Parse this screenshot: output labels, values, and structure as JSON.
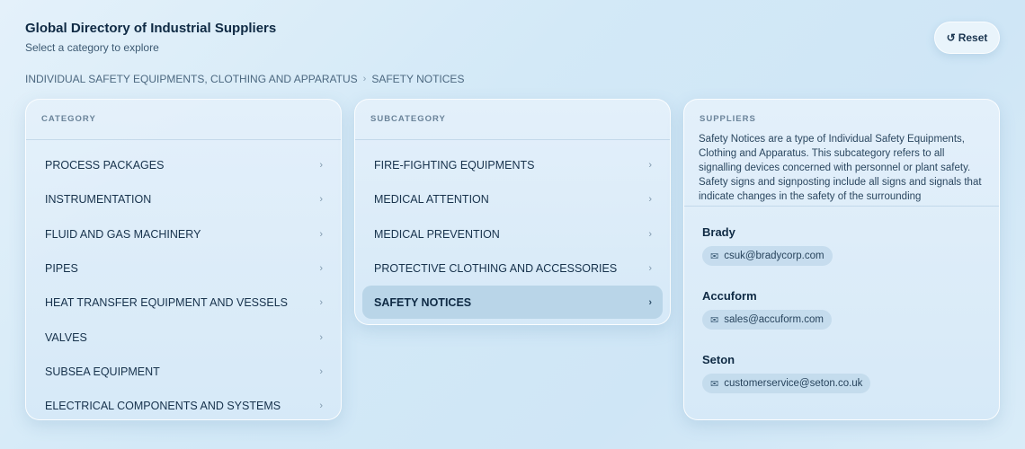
{
  "header": {
    "title": "Global Directory of Industrial Suppliers",
    "subtitle": "Select a category to explore",
    "reset_label": "Reset",
    "reset_icon": "↺"
  },
  "breadcrumb": {
    "items": [
      "INDIVIDUAL SAFETY EQUIPMENTS, CLOTHING AND APPARATUS",
      "SAFETY NOTICES"
    ],
    "separator": "›"
  },
  "category": {
    "heading": "CATEGORY",
    "items": [
      "PROCESS PACKAGES",
      "INSTRUMENTATION",
      "FLUID AND GAS MACHINERY",
      "PIPES",
      "HEAT TRANSFER EQUIPMENT AND VESSELS",
      "VALVES",
      "SUBSEA EQUIPMENT",
      "ELECTRICAL COMPONENTS AND SYSTEMS"
    ]
  },
  "subcategory": {
    "heading": "SUBCATEGORY",
    "items": [
      "FIRE-FIGHTING EQUIPMENTS",
      "MEDICAL ATTENTION",
      "MEDICAL PREVENTION",
      "PROTECTIVE CLOTHING AND ACCESSORIES",
      "SAFETY NOTICES"
    ],
    "selected": "SAFETY NOTICES"
  },
  "suppliers": {
    "heading": "SUPPLIERS",
    "description": "Safety Notices are a type of Individual Safety Equipments, Clothing and Apparatus. This subcategory refers to all signalling devices concerned with personnel or plant safety. Safety signs and signposting include all signs and signals that indicate changes in the safety of the surrounding",
    "list": [
      {
        "name": "Brady",
        "email": "csuk@bradycorp.com"
      },
      {
        "name": "Accuform",
        "email": "sales@accuform.com"
      },
      {
        "name": "Seton",
        "email": "customerservice@seton.co.uk"
      }
    ]
  },
  "icons": {
    "chevron": "›",
    "mail": "✉"
  }
}
